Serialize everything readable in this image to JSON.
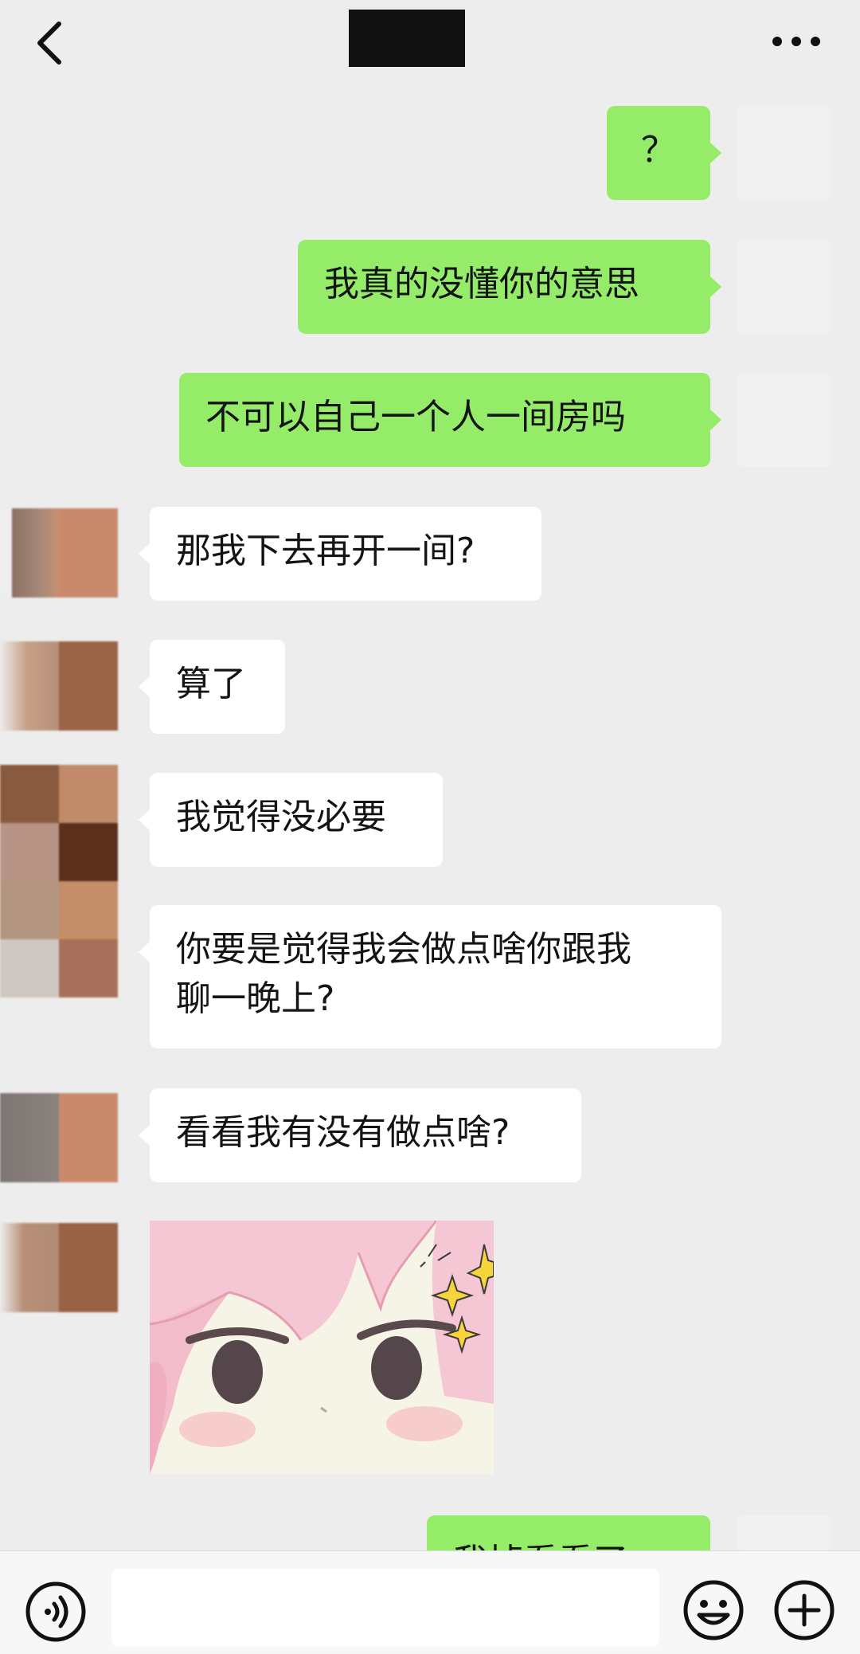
{
  "header": {
    "back_icon": "chevron-left-icon",
    "more_icon": "more-horizontal-icon",
    "title_redacted": true
  },
  "messages": [
    {
      "side": "self",
      "text": "？"
    },
    {
      "side": "self",
      "text": "我真的没懂你的意思"
    },
    {
      "side": "self",
      "text": "不可以自己一个人一间房吗"
    },
    {
      "side": "other",
      "text": "那我下去再开一间?"
    },
    {
      "side": "other",
      "text": "算了"
    },
    {
      "side": "other",
      "text": "我觉得没必要"
    },
    {
      "side": "other",
      "lines": [
        "你要是觉得我会做点啥你跟我",
        "聊一晚上?"
      ]
    },
    {
      "side": "other",
      "text": "看看我有没有做点啥?"
    },
    {
      "side": "other",
      "type": "sticker",
      "sticker": "pink-hair-anime-girl-sparkle"
    },
    {
      "side": "self",
      "text": "我掉看看了"
    }
  ],
  "input_bar": {
    "voice_icon": "voice-icon",
    "emoji_icon": "emoji-icon",
    "plus_icon": "plus-icon",
    "input_placeholder": ""
  },
  "colors": {
    "background": "#ededed",
    "self_bubble": "#95ec69",
    "other_bubble": "#ffffff"
  }
}
